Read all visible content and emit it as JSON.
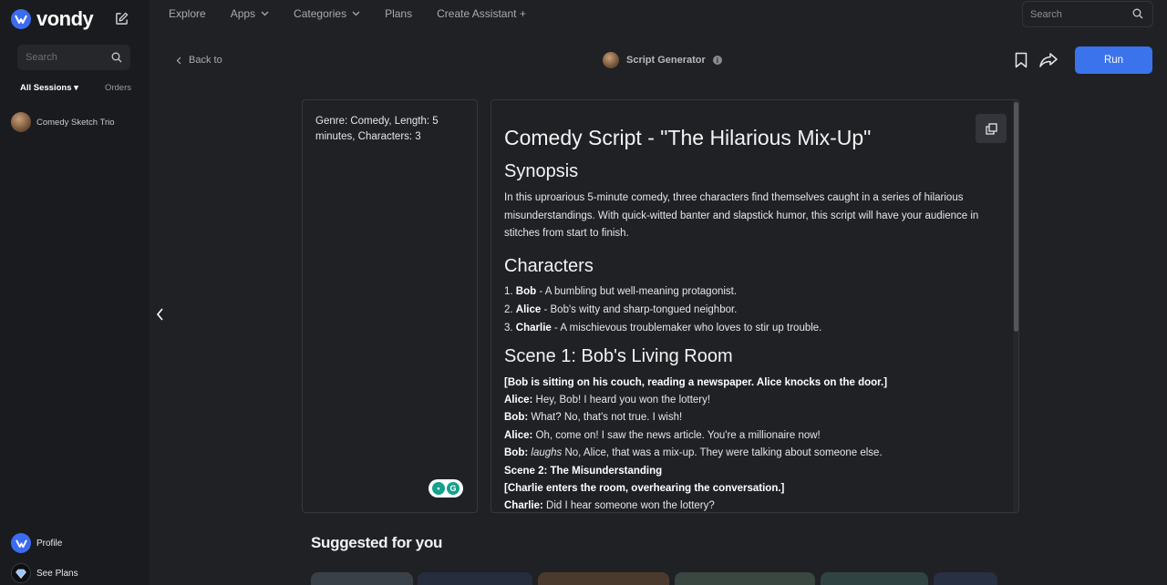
{
  "app": {
    "logo_text": "vondy"
  },
  "sidebar": {
    "search_placeholder": "Search",
    "tabs": {
      "all_sessions": "All Sessions",
      "orders": "Orders"
    },
    "sessions": [
      {
        "label": "Comedy Sketch Trio"
      }
    ],
    "profile_label": "Profile",
    "plans_label": "See Plans"
  },
  "nav": {
    "items": [
      {
        "label": "Explore",
        "dropdown": false
      },
      {
        "label": "Apps",
        "dropdown": true
      },
      {
        "label": "Categories",
        "dropdown": true
      },
      {
        "label": "Plans",
        "dropdown": false
      },
      {
        "label": "Create Assistant +",
        "dropdown": false
      }
    ],
    "search_placeholder": "Search"
  },
  "header": {
    "back_label": "Back to",
    "title": "Script Generator",
    "run_label": "Run",
    "accent_color": "#3b73ec"
  },
  "input": {
    "text": "Genre: Comedy, Length: 5 minutes, Characters: 3"
  },
  "output": {
    "title": "Comedy Script - \"The Hilarious Mix-Up\"",
    "synopsis_heading": "Synopsis",
    "synopsis_text": "In this uproarious 5-minute comedy, three characters find themselves caught in a series of hilarious misunderstandings. With quick-witted banter and slapstick humor, this script will have your audience in stitches from start to finish.",
    "characters_heading": "Characters",
    "characters": [
      {
        "num": "1. ",
        "name": "Bob",
        "desc": " - A bumbling but well-meaning protagonist."
      },
      {
        "num": "2. ",
        "name": "Alice",
        "desc": " - Bob's witty and sharp-tongued neighbor."
      },
      {
        "num": "3. ",
        "name": "Charlie",
        "desc": " - A mischievous troublemaker who loves to stir up trouble."
      }
    ],
    "scene_heading": "Scene 1: Bob's Living Room",
    "dialogue": {
      "stage1": "[Bob is sitting on his couch, reading a newspaper. Alice knocks on the door.]",
      "l1_speaker": "Alice:",
      "l1_text": " Hey, Bob! I heard you won the lottery!",
      "l2_speaker": "Bob:",
      "l2_text": " What? No, that's not true. I wish!",
      "l3_speaker": "Alice:",
      "l3_text": " Oh, come on! I saw the news article. You're a millionaire now!",
      "l4_speaker": "Bob:",
      "l4_action": "laughs",
      "l4_text": " No, Alice, that was a mix-up. They were talking about someone else.",
      "scene2": "Scene 2: The Misunderstanding",
      "stage2": "[Charlie enters the room, overhearing the conversation.]",
      "l5_speaker": "Charlie:",
      "l5_text": " Did I hear someone won the lottery?"
    }
  },
  "suggested": {
    "heading": "Suggested for you"
  }
}
